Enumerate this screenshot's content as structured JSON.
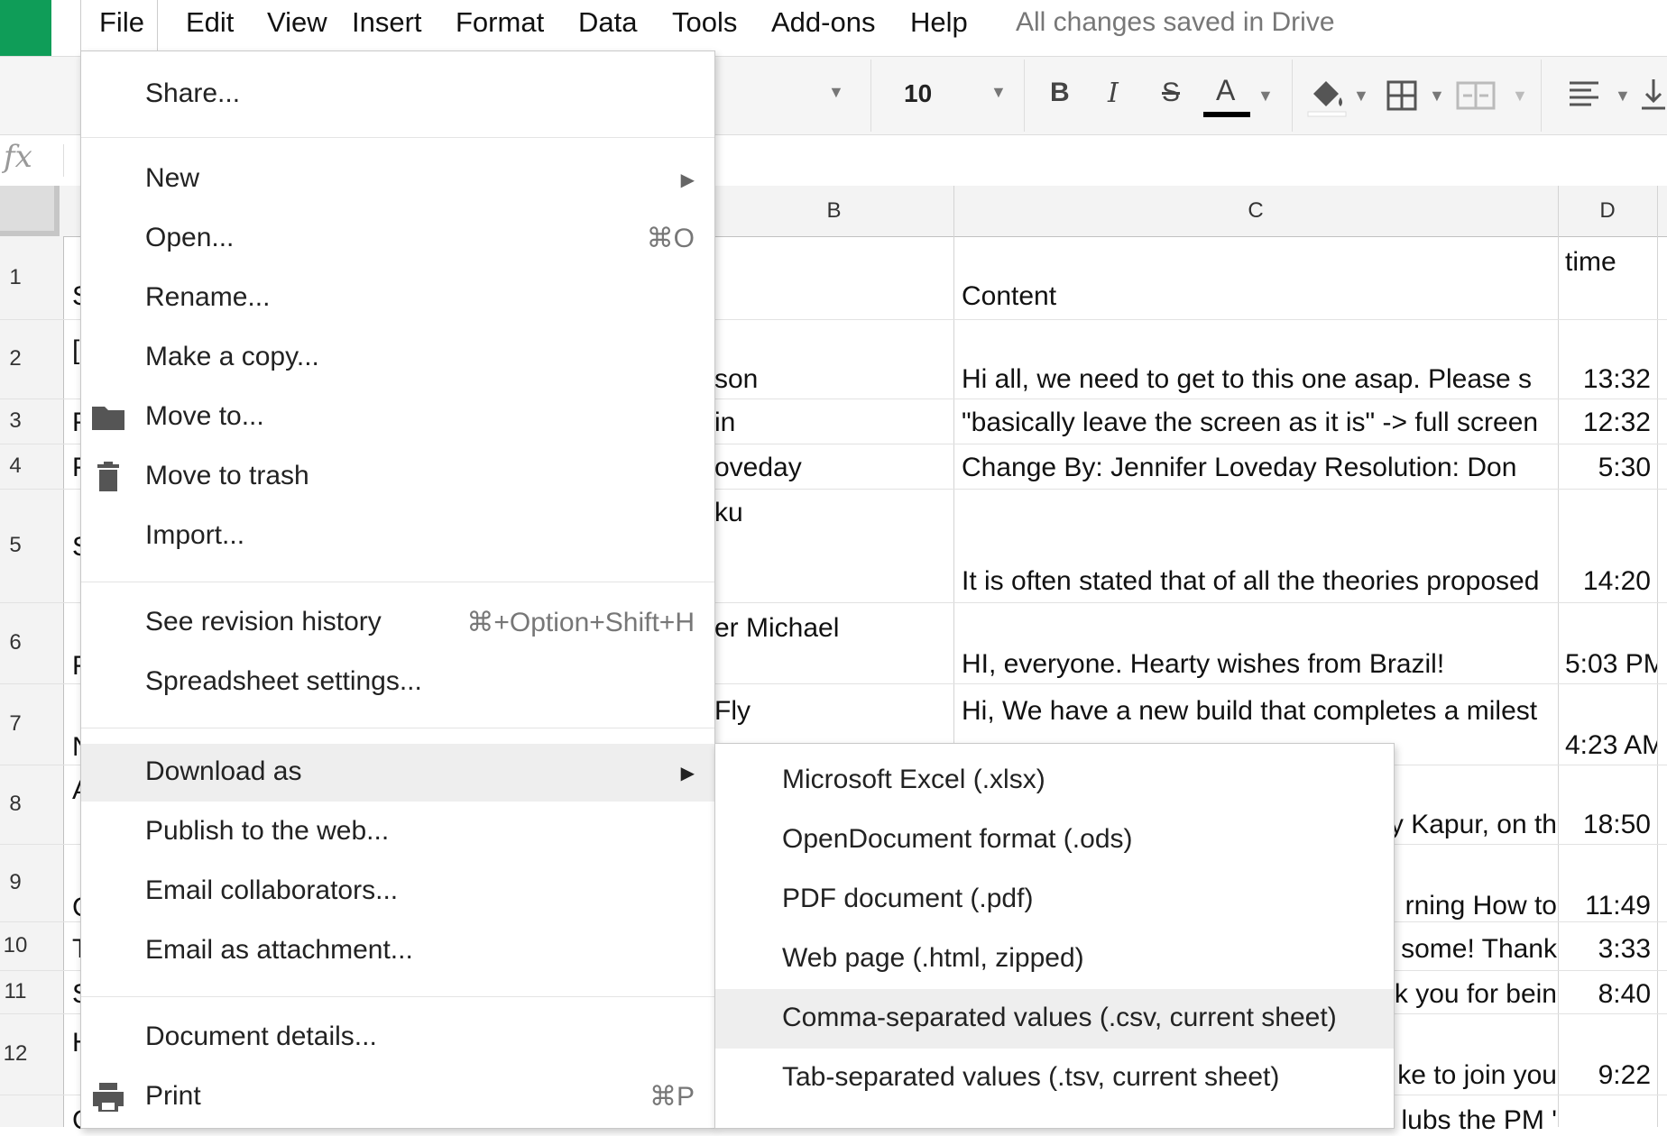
{
  "menubar": {
    "items": [
      "File",
      "Edit",
      "View",
      "Insert",
      "Format",
      "Data",
      "Tools",
      "Add-ons",
      "Help"
    ],
    "saved_status": "All changes saved in Drive"
  },
  "toolbar": {
    "font_size": "10",
    "bold": "B",
    "italic": "I",
    "strikethrough": "S",
    "text_color": "A"
  },
  "formula_bar": {
    "fx_label": "fx"
  },
  "columns": [
    "B",
    "C",
    "D"
  ],
  "rows": [
    "1",
    "2",
    "3",
    "4",
    "5",
    "6",
    "7",
    "8",
    "9",
    "10",
    "11",
    "12"
  ],
  "cells": {
    "c1": "Content",
    "d1": "time",
    "b2": "son",
    "c2": "Hi all, we need to get to this one asap. Please s",
    "d2": "13:32",
    "b3": "in",
    "c3": "\"basically leave the screen as it is\" -> full screen",
    "d3": "12:32",
    "b4": "oveday",
    "c4": "Change By:  Jennifer Loveday Resolution:   Don",
    "d4": "5:30",
    "b5": "ku",
    "c5": "It is often stated that of all the theories proposed",
    "d5": "14:20",
    "b6": "er Michael",
    "c6": "HI, everyone. Hearty wishes from Brazil!",
    "d6": "5:03 PM",
    "b7": "Fly",
    "c7": "Hi, We have a new build that completes a milest",
    "d7": "4:23 AM",
    "c8": "y Kapur, on th",
    "d8": "18:50",
    "c9": "rning How to",
    "d9": "11:49",
    "c10": "some! Thank",
    "d10": "3:33",
    "c11": "k you for bein",
    "d11": "8:40",
    "c12": "ke to join you",
    "d12": "9:22",
    "c13": "lubs the PM '"
  },
  "row_a_partial": [
    "S",
    "[",
    "F",
    "F",
    "S",
    "F",
    "N",
    "A",
    "C",
    "T",
    "S",
    "H",
    "C"
  ],
  "file_menu": {
    "share": "Share...",
    "new": "New",
    "open": "Open...",
    "open_shortcut": "⌘O",
    "rename": "Rename...",
    "make_copy": "Make a copy...",
    "move_to": "Move to...",
    "move_to_trash": "Move to trash",
    "import": "Import...",
    "revision_history": "See revision history",
    "revision_history_shortcut": "⌘+Option+Shift+H",
    "spreadsheet_settings": "Spreadsheet settings...",
    "download_as": "Download as",
    "publish": "Publish to the web...",
    "email_collaborators": "Email collaborators...",
    "email_attachment": "Email as attachment...",
    "document_details": "Document details...",
    "print": "Print",
    "print_shortcut": "⌘P"
  },
  "download_submenu": {
    "items": [
      "Microsoft Excel (.xlsx)",
      "OpenDocument format (.ods)",
      "PDF document (.pdf)",
      "Web page (.html, zipped)",
      "Comma-separated values (.csv, current sheet)",
      "Tab-separated values (.tsv, current sheet)"
    ],
    "highlighted_index": 4
  },
  "colors": {
    "brand_green": "#0f9d58",
    "menu_highlight": "#eeeeee"
  }
}
